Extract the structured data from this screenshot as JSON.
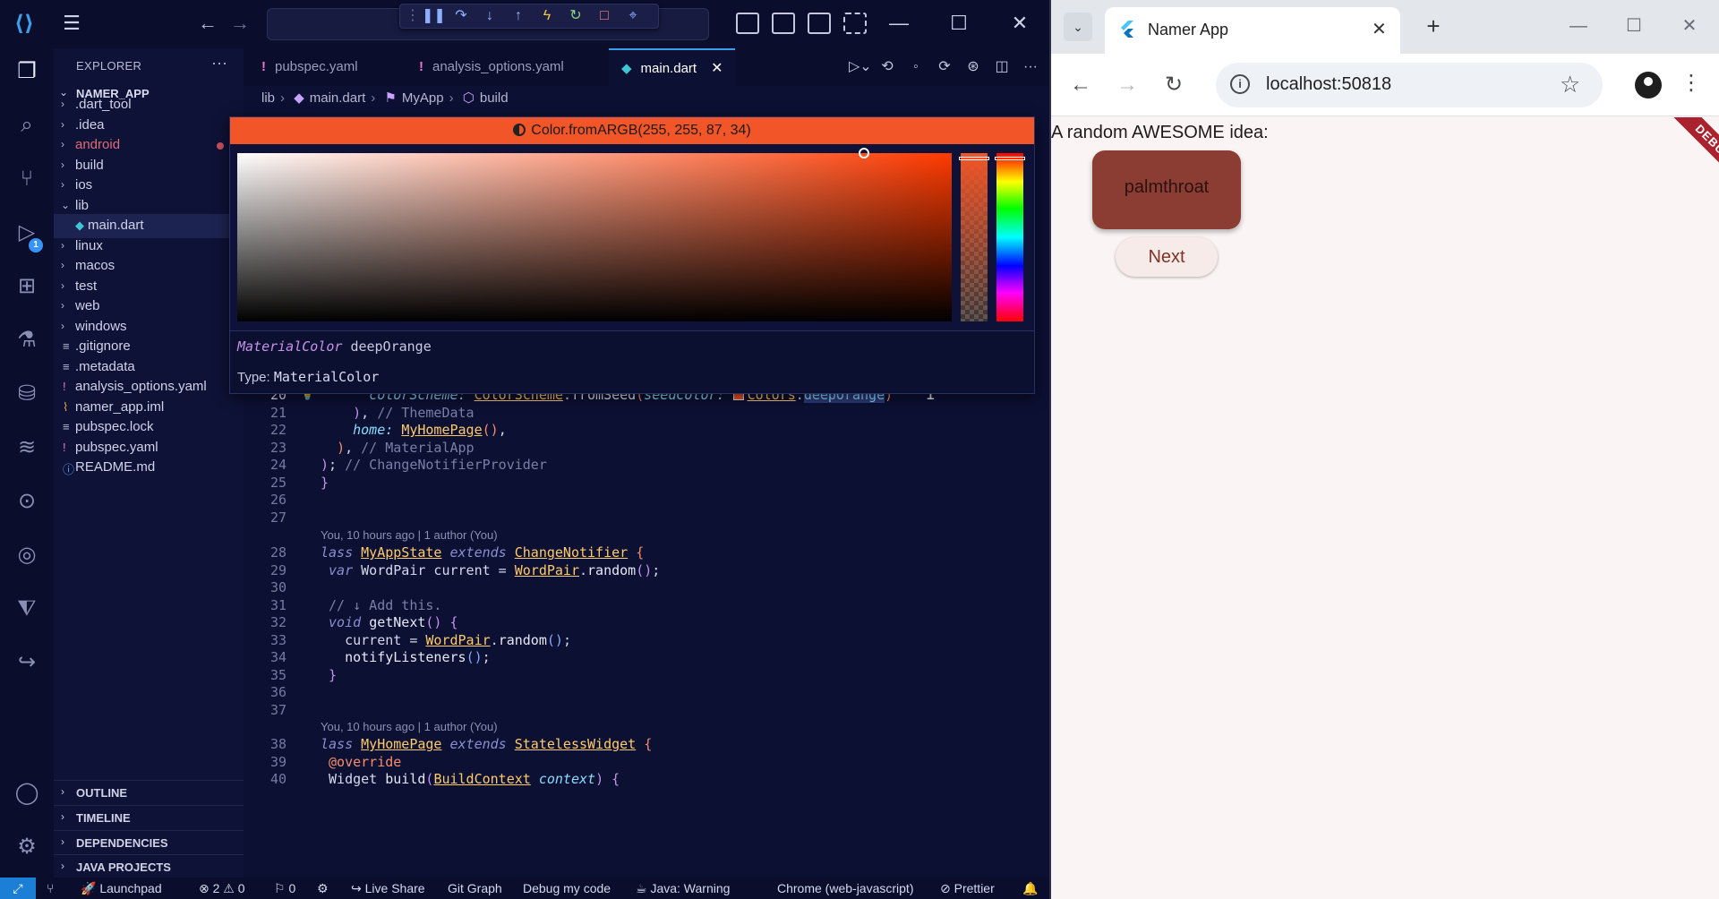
{
  "vscode": {
    "titlebar": {
      "logo_icon": "vscode-logo-icon",
      "menu_icon": "hamburger-menu-icon",
      "back_icon": "arrow-left-icon",
      "forward_icon": "arrow-right-icon",
      "debug_toolbar": [
        "grip-icon",
        "pause-icon",
        "step-over-icon",
        "step-into-icon",
        "step-out-icon",
        "hot-reload-icon",
        "restart-icon",
        "stop-icon",
        "inspect-icon"
      ]
    },
    "activitybar": {
      "items": [
        "explorer-icon",
        "search-icon",
        "source-control-icon",
        "run-debug-icon",
        "extensions-icon",
        "testing-icon",
        "database-icon",
        "layers-icon",
        "git-graph-icon",
        "remote-icon",
        "flutter-icon",
        "live-share-icon",
        "account-icon",
        "settings-gear-icon"
      ],
      "debug_badge": "1"
    },
    "sidebar": {
      "title": "EXPLORER",
      "more": "···",
      "project": "NAMER_APP",
      "tree": [
        {
          "label": ".dart_tool",
          "kind": "folder"
        },
        {
          "label": ".idea",
          "kind": "folder"
        },
        {
          "label": "android",
          "kind": "folder",
          "modified": true
        },
        {
          "label": "build",
          "kind": "folder"
        },
        {
          "label": "ios",
          "kind": "folder"
        },
        {
          "label": "lib",
          "kind": "folder-open"
        },
        {
          "label": "main.dart",
          "kind": "dart-file",
          "selected": true
        },
        {
          "label": "linux",
          "kind": "folder"
        },
        {
          "label": "macos",
          "kind": "folder"
        },
        {
          "label": "test",
          "kind": "folder"
        },
        {
          "label": "web",
          "kind": "folder"
        },
        {
          "label": "windows",
          "kind": "folder"
        },
        {
          "label": ".gitignore",
          "kind": "file"
        },
        {
          "label": ".metadata",
          "kind": "file"
        },
        {
          "label": "analysis_options.yaml",
          "kind": "yaml-file"
        },
        {
          "label": "namer_app.iml",
          "kind": "rss-file"
        },
        {
          "label": "pubspec.lock",
          "kind": "file"
        },
        {
          "label": "pubspec.yaml",
          "kind": "yaml-file"
        },
        {
          "label": "README.md",
          "kind": "info-file"
        }
      ],
      "sections": [
        "OUTLINE",
        "TIMELINE",
        "DEPENDENCIES",
        "JAVA PROJECTS"
      ]
    },
    "tabs": [
      {
        "label": "pubspec.yaml",
        "icon": "!"
      },
      {
        "label": "analysis_options.yaml",
        "icon": "!"
      },
      {
        "label": "main.dart",
        "icon": "◆",
        "active": true
      }
    ],
    "breadcrumb": [
      "lib",
      "main.dart",
      "MyApp",
      "build"
    ],
    "color_picker": {
      "header": "Color.fromARGB(255, 255, 87, 34)",
      "hover_type_keyword": "MaterialColor",
      "hover_name": "deepOrange",
      "type_label": "Type:",
      "type_value": "MaterialColor",
      "color": "#f25527"
    },
    "code": {
      "line_numbers": [
        "20",
        "21",
        "22",
        "23",
        "24",
        "25",
        "26",
        "27",
        "28",
        "29",
        "30",
        "31",
        "32",
        "33",
        "34",
        "35",
        "36",
        "37",
        "38",
        "39",
        "40"
      ],
      "lens_1": "You, 10 hours ago | 1 author (You)",
      "lens_2": "You, 10 hours ago | 1 author (You)"
    },
    "statusbar": {
      "remote_icon": "remote-icon",
      "launchpad": "Launchpad",
      "errors": "2",
      "warnings": "0",
      "radio": "0",
      "live_share": "Live Share",
      "git_graph": "Git Graph",
      "debug_code": "Debug my code",
      "java": "Java: Warning",
      "chrome": "Chrome (web-javascript)",
      "prettier": "Prettier"
    }
  },
  "browser": {
    "tab_title": "Namer App",
    "url": "localhost:50818",
    "page": {
      "intro": "A random AWESOME idea:",
      "word": "palmthroat",
      "next_label": "Next",
      "debug_banner": "DEBUG"
    }
  }
}
